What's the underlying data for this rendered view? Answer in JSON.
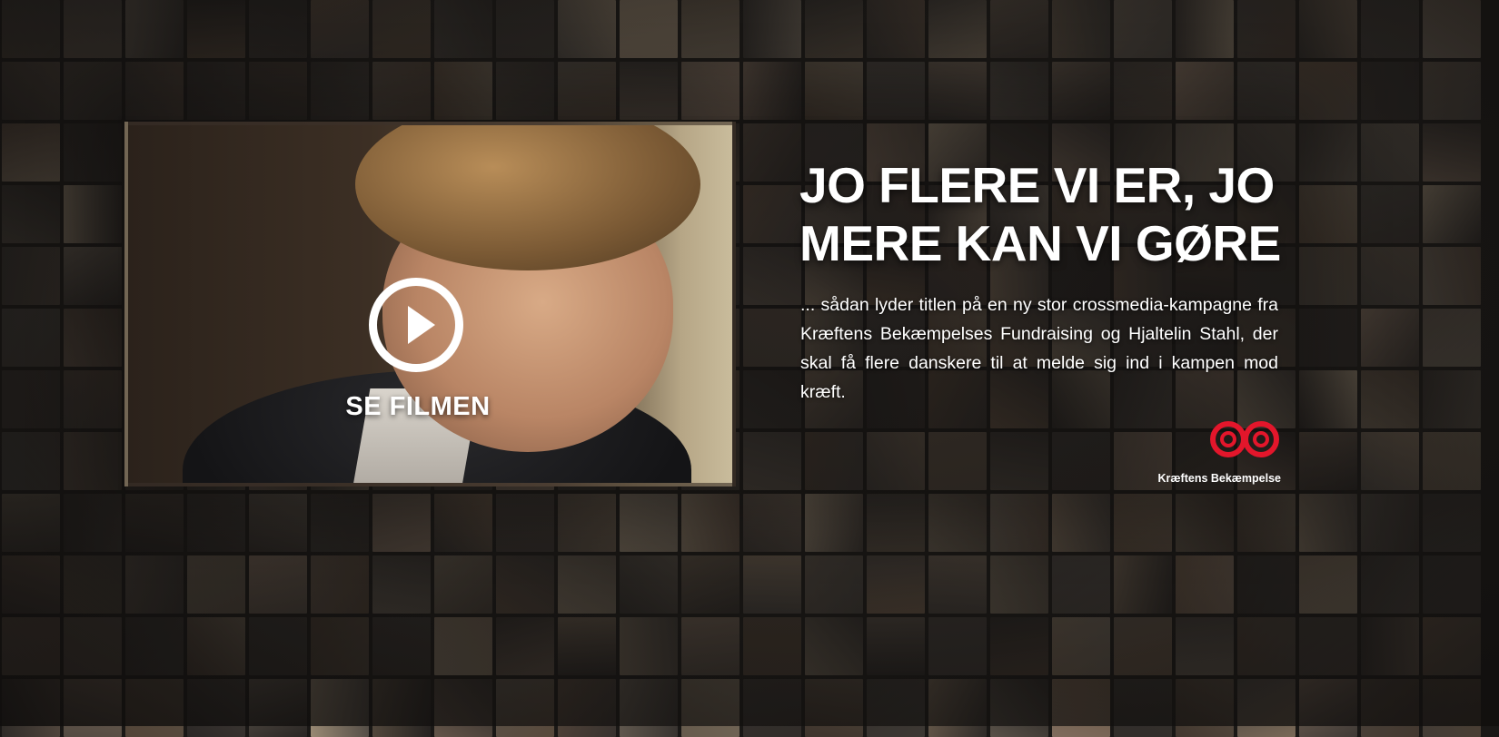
{
  "video": {
    "play_label": "SE FILMEN"
  },
  "campaign": {
    "headline_line1": "JO FLERE VI ER, JO",
    "headline_line2": "MERE KAN VI GØRE",
    "lead": "... sådan lyder titlen på en ny stor crossmedia-kampagne fra Kræftens Bekæmpelses Fundraising og Hjaltelin Stahl, der skal få flere danskere til at melde sig ind i kampen mod kræft."
  },
  "logo": {
    "name": "Kræftens Bekæmpelse",
    "color": "#e3162b"
  },
  "icons": {
    "play": "play-icon",
    "logo_mark": "infinity-logo-icon"
  }
}
